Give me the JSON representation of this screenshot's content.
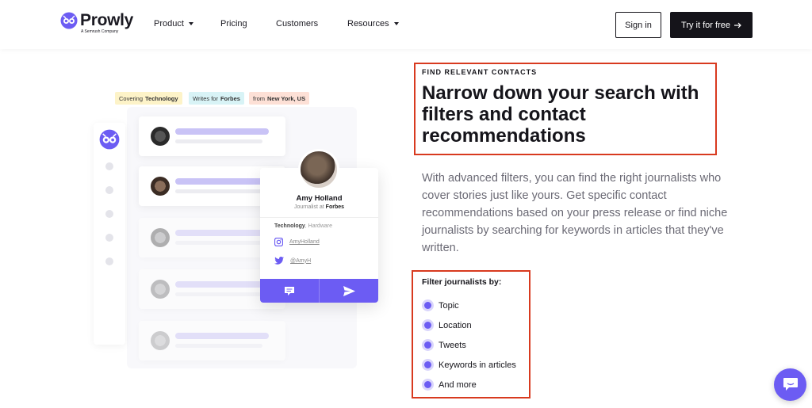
{
  "header": {
    "logo": {
      "name": "Prowly",
      "sub": "A Semrush Company"
    },
    "nav": [
      {
        "label": "Product",
        "dropdown": true
      },
      {
        "label": "Pricing",
        "dropdown": false
      },
      {
        "label": "Customers",
        "dropdown": false
      },
      {
        "label": "Resources",
        "dropdown": true
      }
    ],
    "sign_in": "Sign in",
    "try_free": "Try it for free"
  },
  "illustration": {
    "tags": [
      {
        "prefix": "Covering",
        "value": "Technology",
        "color": "#fdf3c8"
      },
      {
        "prefix": "Writes for",
        "value": "Forbes",
        "color": "#d8f3f6"
      },
      {
        "prefix": "from",
        "value": "New York, US",
        "color": "#fde0d6"
      }
    ],
    "profile": {
      "name": "Amy Holland",
      "role_prefix": "Journalist at",
      "role_company": "Forbes",
      "topic_main": "Technology",
      "topic_rest": ", Hardware",
      "instagram": "AmyHolland",
      "twitter": "@AmyH"
    }
  },
  "content": {
    "eyebrow": "FIND RELEVANT CONTACTS",
    "headline": "Narrow down your search with filters and contact recommendations",
    "paragraph": "With advanced filters, you can find the right journalists who cover stories just like yours. Get specific contact recommendations based on your press release or find niche journalists by searching for keywords in articles that they've written.",
    "filter_title": "Filter journalists by:",
    "filters": [
      "Topic",
      "Location",
      "Tweets",
      "Keywords in articles",
      "And more"
    ]
  },
  "colors": {
    "accent": "#6c5cf3",
    "highlight_border": "#d83a1f",
    "dark": "#15141a"
  }
}
